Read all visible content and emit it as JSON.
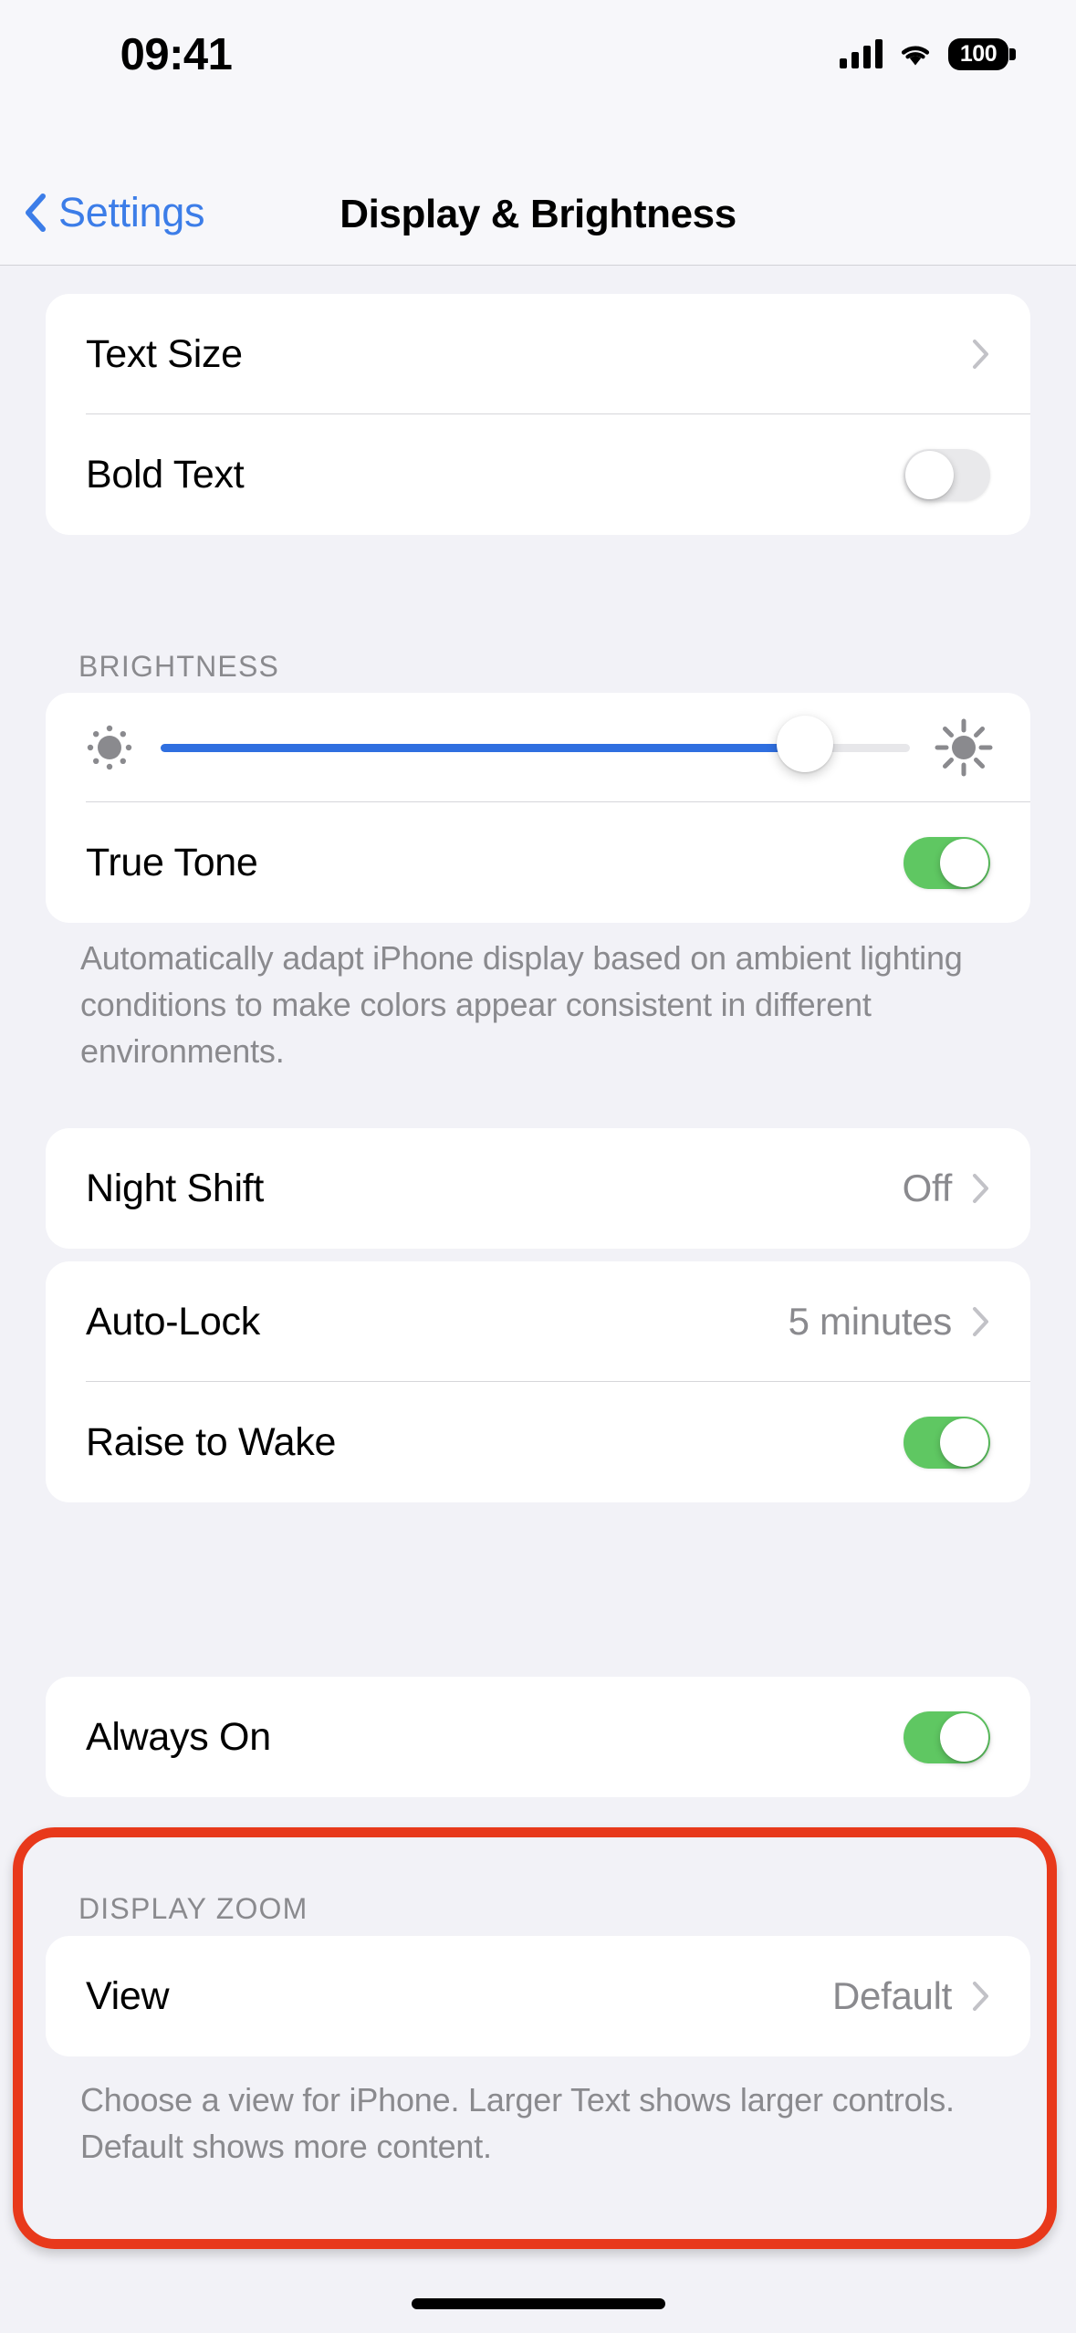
{
  "status_bar": {
    "time": "09:41",
    "cellular_icon": "cellular-bars-icon",
    "wifi_icon": "wifi-icon",
    "battery_level": "100"
  },
  "nav": {
    "back_label": "Settings",
    "back_icon": "chevron-left-icon",
    "title": "Display & Brightness"
  },
  "sections": {
    "text": {
      "rows": [
        {
          "label": "Text Size",
          "accessory": "chevron-right-icon"
        },
        {
          "label": "Bold Text",
          "accessory": "toggle",
          "toggle_state": "off"
        }
      ]
    },
    "brightness": {
      "header": "BRIGHTNESS",
      "slider": {
        "low_icon": "sun-min-icon",
        "high_icon": "sun-max-icon",
        "value_percent": 86
      },
      "true_tone": {
        "label": "True Tone",
        "toggle_state": "on"
      },
      "footer": "Automatically adapt iPhone display based on ambient lighting conditions to make colors appear consistent in different environments."
    },
    "night_shift": {
      "rows": [
        {
          "label": "Night Shift",
          "value": "Off",
          "accessory": "chevron-right-icon"
        }
      ]
    },
    "lock": {
      "rows": [
        {
          "label": "Auto-Lock",
          "value": "5 minutes",
          "accessory": "chevron-right-icon"
        },
        {
          "label": "Raise to Wake",
          "accessory": "toggle",
          "toggle_state": "on"
        }
      ]
    },
    "always_on": {
      "rows": [
        {
          "label": "Always On",
          "accessory": "toggle",
          "toggle_state": "on"
        }
      ]
    },
    "display_zoom": {
      "header": "DISPLAY ZOOM",
      "rows": [
        {
          "label": "View",
          "value": "Default",
          "accessory": "chevron-right-icon"
        }
      ],
      "footer": "Choose a view for iPhone. Larger Text shows larger controls. Default shows more content."
    }
  },
  "annotation": {
    "shape": "rounded-rectangle-highlight",
    "color": "#E8391B",
    "target": "display-zoom-section"
  },
  "colors": {
    "page_background": "#F2F2F7",
    "card_background": "#FFFFFF",
    "accent_blue": "#3C7DE8",
    "slider_blue": "#2F6FE0",
    "toggle_green": "#5FC762",
    "secondary_text": "#8A8A8E",
    "annotation_red": "#E8391B"
  }
}
